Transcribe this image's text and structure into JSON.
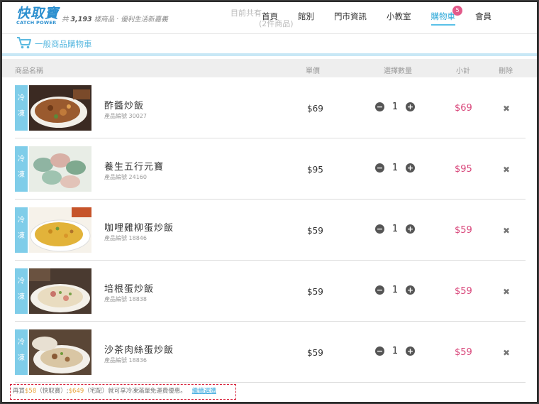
{
  "header": {
    "logo_text": "快取寶",
    "logo_sub": "CATCH POWER",
    "tagline_prefix": "共",
    "tagline_count": "3,193",
    "tagline_suffix": "樣商品 · 優利生活新嘉義",
    "ghost_line1": "目前共有",
    "ghost_line2": "(2件商品)",
    "nav": [
      {
        "label": "首頁"
      },
      {
        "label": "館別"
      },
      {
        "label": "門市資訊"
      },
      {
        "label": "小教室"
      },
      {
        "label": "購物車",
        "badge": "5",
        "active": true
      },
      {
        "label": "會員"
      }
    ]
  },
  "cart": {
    "title": "一般商品購物車",
    "columns": {
      "name": "商品名稱",
      "price": "單價",
      "qty": "選擇數量",
      "subtotal": "小計",
      "delete": "刪除"
    },
    "items": [
      {
        "tag": "冷凍",
        "name": "酢醬炒飯",
        "code": "產品編號 30027",
        "price": "$69",
        "qty": "1",
        "subtotal": "$69",
        "delete": "✖"
      },
      {
        "tag": "冷凍",
        "name": "養生五行元寶",
        "code": "產品編號 24160",
        "price": "$95",
        "qty": "1",
        "subtotal": "$95",
        "delete": "✖"
      },
      {
        "tag": "冷凍",
        "name": "咖哩雞柳蛋炒飯",
        "code": "產品編號 18846",
        "price": "$59",
        "qty": "1",
        "subtotal": "$59",
        "delete": "✖"
      },
      {
        "tag": "冷凍",
        "name": "培根蛋炒飯",
        "code": "產品編號 18838",
        "price": "$59",
        "qty": "1",
        "subtotal": "$59",
        "delete": "✖"
      },
      {
        "tag": "冷凍",
        "name": "沙茶肉絲蛋炒飯",
        "code": "產品編號 18836",
        "price": "$59",
        "qty": "1",
        "subtotal": "$59",
        "delete": "✖"
      }
    ],
    "note": {
      "p1": "再買",
      "amt1": "$58",
      "p2": "（快取寶）;",
      "amt2": "$649",
      "p3": "（宅配）就可享冷凍滿單免運費優惠。",
      "link": "繼續選購"
    }
  },
  "colors": {
    "accent": "#5ab9e0",
    "subtotal": "#d8467a",
    "tag": "#7fcde9",
    "badge": "#e25a8a",
    "note_border": "#d8213a"
  }
}
